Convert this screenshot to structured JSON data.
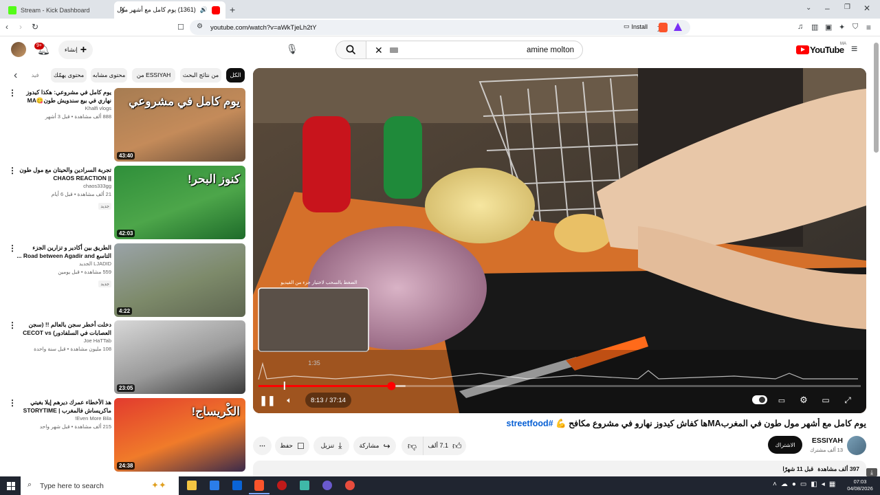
{
  "browser": {
    "tabs": [
      {
        "title": "Stream - Kick Dashboard",
        "active": false
      },
      {
        "title": "(1361) يوم كامل مع أشهر مول",
        "active": true
      }
    ],
    "url": "youtube.com/watch?v=aWkTjeLh2tY",
    "install_label": "Install"
  },
  "header": {
    "search_query": "amine molton",
    "create_label": "إنشاء",
    "notification_count": "9+",
    "logo_text": "YouTube",
    "logo_country": "MA"
  },
  "chips": [
    "الكل",
    "من نتائج البحث",
    "من ESSIYAH",
    "محتوى مشابه",
    "محتوى يهمّك",
    "فيد"
  ],
  "sidebar": [
    {
      "title": "يوم كامل في مشروعي: هكذا كيدوز نهاري في بيع سندويش طون😋MA",
      "channel": "Khalfi vlogs",
      "stats": "888 ألف مشاهدة • قبل 3 أشهر",
      "duration": "43:40",
      "new": "",
      "thumb_text": "يوم كامل في مشروعي",
      "thumb_colors": [
        "#a67c52",
        "#c48b5a",
        "#6b4f3a"
      ]
    },
    {
      "title": "تجربة السرادين والحيتان مع مول طون || CHAOS REACTION",
      "channel": "chaos333gg",
      "stats": "21 ألف مشاهدة • قبل 6 أيام",
      "duration": "42:03",
      "new": "جديد",
      "thumb_text": "كنوز البحر!",
      "thumb_colors": [
        "#2f8f3a",
        "#4da64a",
        "#1e6b2a"
      ]
    },
    {
      "title": "الطريق بين أكادير و تزارين الجزء التاسع Road between Agadir and ...",
      "channel": "LJADID الجديد",
      "stats": "559 مشاهدة • قبل يومين",
      "duration": "4:22",
      "new": "جديد",
      "thumb_text": "",
      "thumb_colors": [
        "#9aa3a8",
        "#7d8a6a",
        "#5e6650"
      ]
    },
    {
      "title": "دخلت أخطر سجن بالعالم !! (سجن العصابات في السلفادور) CECOT vs",
      "channel": "Joe HaTTab",
      "stats": "108 مليون مشاهدة • قبل سنة واحدة",
      "duration": "23:05",
      "new": "",
      "thumb_text": "",
      "thumb_colors": [
        "#d8d8d8",
        "#9a9a9a",
        "#3a3a3a"
      ]
    },
    {
      "title": "هذ الأخطاء عمرك ديرهم إيلا بغيتي ماكريساش فالمغرب | STORYTIME",
      "channel": "Even More Bila!",
      "stats": "215 ألف مشاهدة • قبل شهر واحد",
      "duration": "24:38",
      "new": "",
      "thumb_text": "الكْريساج!",
      "thumb_colors": [
        "#e23b2e",
        "#f07b2a",
        "#3a2a4a"
      ]
    }
  ],
  "player": {
    "current_time": "8:13",
    "duration": "37:14",
    "separator": "/",
    "progress": 0.2207,
    "buffered": 0.244,
    "hover_time": "1:35",
    "hover_fraction": 0.042,
    "preview_caption": "الضغط بالسحب لاختيار جزء من الفيديو"
  },
  "video": {
    "title": "يوم كامل مع أشهر مول طون في المغربMAها كفاش كيدوز نهارو في مشروع مكافح 💪",
    "hashtag": "#streetfood",
    "channel": "ESSIYAH",
    "subscribers": "13 ألف مشترك",
    "subscribe_label": "الاشتراك",
    "likes": "7.1 ألف",
    "share_label": "مشاركة",
    "download_label": "تنزيل",
    "save_label": "حفظ",
    "views": "397 ألف مشاهدة",
    "age": "قبل 11 شهرًا"
  },
  "taskbar": {
    "search_placeholder": "Type here to search",
    "time": "07:03",
    "date": "04/08/2026"
  }
}
